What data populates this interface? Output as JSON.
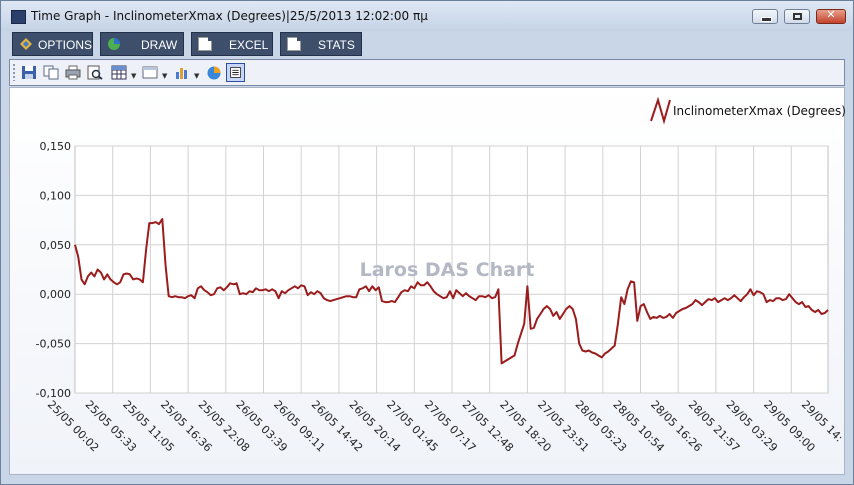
{
  "window": {
    "title": "Time Graph - InclinometerXmax (Degrees)|25/5/2013 12:02:00 πμ",
    "min_glyph": "–",
    "max_glyph": "▢",
    "close_glyph": "✕"
  },
  "menu": {
    "options_label": "OPTIONS",
    "draw_label": "DRAW",
    "excel_label": "EXCEL",
    "stats_label": "STATS"
  },
  "toolbar": {
    "icons": [
      "save-icon",
      "copy-icon",
      "print-icon",
      "print-preview-icon",
      "grid-icon",
      "window-icon",
      "bar-chart-icon",
      "pie-chart-icon",
      "legend-icon"
    ]
  },
  "chart_data": {
    "type": "line",
    "watermark": "Laros DAS Chart",
    "legend_position": "top-right",
    "grid": true,
    "series": [
      {
        "name": "InclinometerXmax (Degrees)",
        "color": "#9b1c1c",
        "values": [
          0.05,
          0.038,
          0.015,
          0.01,
          0.018,
          0.022,
          0.018,
          0.025,
          0.022,
          0.015,
          0.02,
          0.015,
          0.012,
          0.01,
          0.012,
          0.02,
          0.021,
          0.02,
          0.015,
          0.016,
          0.015,
          0.012,
          0.045,
          0.072,
          0.072,
          0.073,
          0.071,
          0.076,
          0.03,
          -0.002,
          -0.003,
          -0.002,
          -0.003,
          -0.003,
          -0.004,
          -0.002,
          -0.001,
          -0.004,
          0.006,
          0.008,
          0.004,
          0.002,
          -0.001,
          0.0,
          0.006,
          0.007,
          0.004,
          0.007,
          0.011,
          0.01,
          0.011,
          0.0,
          0.001,
          0.0,
          0.003,
          0.002,
          0.006,
          0.004,
          0.004,
          0.005,
          0.003,
          0.005,
          0.003,
          -0.004,
          0.003,
          0.001,
          0.004,
          0.006,
          0.008,
          0.006,
          0.009,
          0.008,
          -0.001,
          0.002,
          0.0,
          0.003,
          0.001,
          -0.004,
          -0.006,
          -0.007,
          -0.006,
          -0.005,
          -0.004,
          -0.003,
          -0.002,
          -0.002,
          -0.003,
          -0.003,
          0.005,
          0.006,
          0.008,
          0.003,
          0.008,
          0.004,
          0.007,
          -0.007,
          -0.008,
          -0.008,
          -0.007,
          -0.008,
          -0.003,
          0.002,
          0.004,
          0.003,
          0.008,
          0.006,
          0.012,
          0.009,
          0.009,
          0.012,
          0.008,
          0.003,
          0.0,
          -0.002,
          -0.004,
          -0.003,
          0.003,
          -0.004,
          0.004,
          0.001,
          -0.002,
          0.001,
          -0.002,
          -0.004,
          -0.006,
          -0.002,
          -0.002,
          -0.003,
          -0.001,
          -0.004,
          -0.003,
          0.005,
          -0.07,
          -0.068,
          -0.066,
          -0.064,
          -0.062,
          -0.05,
          -0.04,
          -0.03,
          0.008,
          -0.035,
          -0.034,
          -0.025,
          -0.02,
          -0.015,
          -0.012,
          -0.015,
          -0.022,
          -0.018,
          -0.025,
          -0.02,
          -0.015,
          -0.012,
          -0.015,
          -0.025,
          -0.05,
          -0.057,
          -0.058,
          -0.057,
          -0.059,
          -0.06,
          -0.062,
          -0.064,
          -0.06,
          -0.058,
          -0.055,
          -0.052,
          -0.03,
          -0.003,
          -0.01,
          0.005,
          0.013,
          0.012,
          -0.027,
          -0.012,
          -0.01,
          -0.018,
          -0.025,
          -0.023,
          -0.024,
          -0.022,
          -0.024,
          -0.023,
          -0.02,
          -0.024,
          -0.019,
          -0.017,
          -0.015,
          -0.014,
          -0.012,
          -0.01,
          -0.006,
          -0.008,
          -0.011,
          -0.008,
          -0.005,
          -0.006,
          -0.004,
          -0.008,
          -0.006,
          -0.004,
          -0.006,
          -0.004,
          -0.001,
          -0.004,
          -0.007,
          -0.003,
          0.0,
          0.005,
          -0.001,
          0.003,
          0.002,
          0.0,
          -0.008,
          -0.006,
          -0.007,
          -0.004,
          -0.004,
          -0.006,
          -0.005,
          0.0,
          -0.004,
          -0.008,
          -0.01,
          -0.008,
          -0.013,
          -0.012,
          -0.016,
          -0.018,
          -0.016,
          -0.02,
          -0.019,
          -0.016
        ]
      }
    ],
    "x_tick_labels": [
      "25/05 00:02",
      "25/05 05:33",
      "25/05 11:05",
      "25/05 16:36",
      "25/05 22:08",
      "26/05 03:39",
      "26/05 09:11",
      "26/05 14:42",
      "26/05 20:14",
      "27/05 01:45",
      "27/05 07:17",
      "27/05 12:48",
      "27/05 18:20",
      "27/05 23:51",
      "28/05 05:23",
      "28/05 10:54",
      "28/05 16:26",
      "28/05 21:57",
      "29/05 03:29",
      "29/05 09:00",
      "29/05 14:"
    ],
    "y_tick_labels": [
      "0,150",
      "0,100",
      "0,050",
      "0,000",
      "-0,050",
      "-0,100"
    ],
    "y_ticks": [
      0.15,
      0.1,
      0.05,
      0.0,
      -0.05,
      -0.1
    ],
    "ylim": [
      -0.1,
      0.15
    ]
  }
}
